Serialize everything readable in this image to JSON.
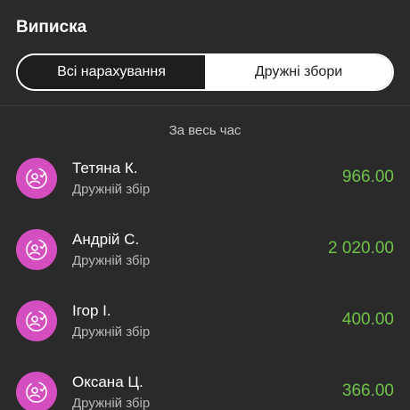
{
  "header": {
    "title": "Виписка"
  },
  "tabs": [
    {
      "label": "Всі нарахування",
      "active": false
    },
    {
      "label": "Дружні збори",
      "active": true
    }
  ],
  "period_label": "За весь час",
  "colors": {
    "background": "#2a2a2a",
    "avatar": "#d44ec0",
    "amount": "#6fc24a"
  },
  "items": [
    {
      "name": "Тетяна К.",
      "subtitle": "Дружній збір",
      "amount": "966.00",
      "icon": "friends-collection-icon"
    },
    {
      "name": "Андрій С.",
      "subtitle": "Дружній збір",
      "amount": "2 020.00",
      "icon": "friends-collection-icon"
    },
    {
      "name": "Ігор І.",
      "subtitle": "Дружній збір",
      "amount": "400.00",
      "icon": "friends-collection-icon"
    },
    {
      "name": "Оксана Ц.",
      "subtitle": "Дружній збір",
      "amount": "366.00",
      "icon": "friends-collection-icon"
    }
  ]
}
